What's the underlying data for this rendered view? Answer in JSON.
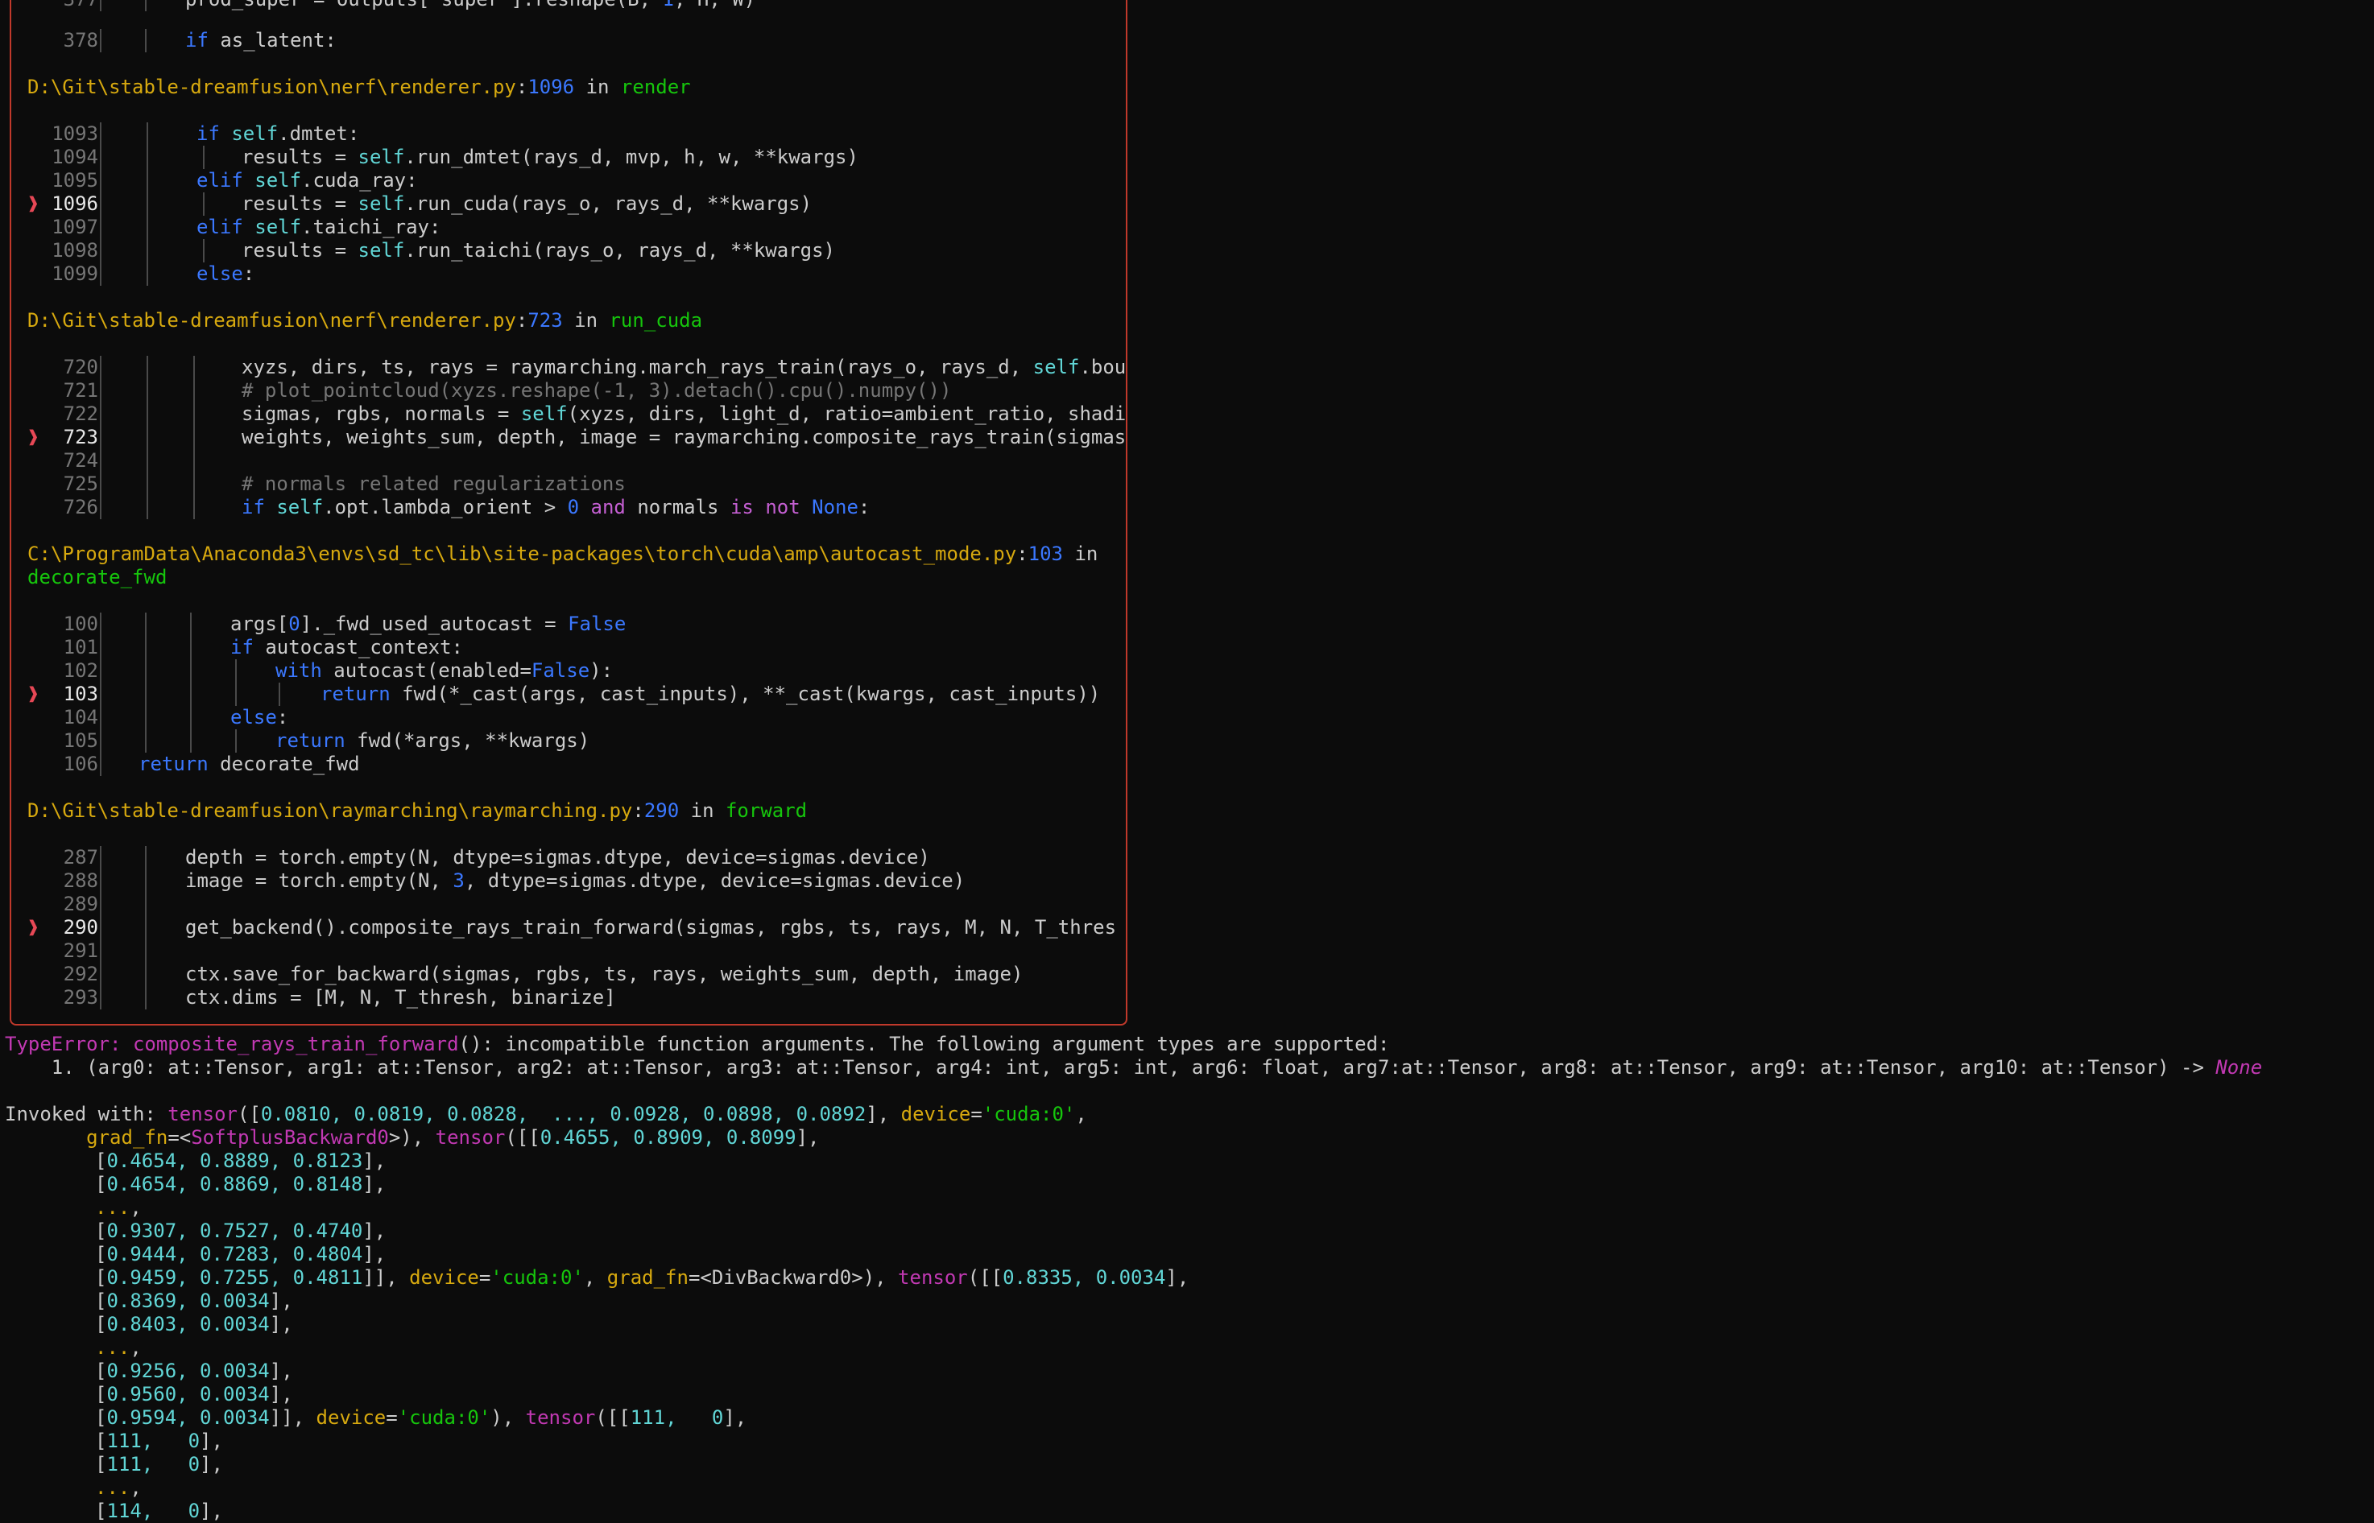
{
  "traceback": {
    "frames": [
      {
        "header": {
          "path": "",
          "line": "",
          "in": "",
          "func": ""
        },
        "lines": [
          {
            "no": "377",
            "code": "prod_super = outputs['super'].reshape(B, 1, H, W)",
            "partial": true
          },
          {
            "no": "378",
            "code": "if as_latent:"
          }
        ]
      }
    ],
    "frame1": {
      "path": "D:\\Git\\stable-dreamfusion\\nerf\\renderer.py",
      "colon": ":",
      "line": "1096",
      "in": " in ",
      "func": "render"
    },
    "frame1_lines": [
      {
        "no": "1093",
        "code": "if self.dmtet:"
      },
      {
        "no": "1094",
        "code": "results = self.run_dmtet(rays_d, mvp, h, w, **kwargs)"
      },
      {
        "no": "1095",
        "code": "elif self.cuda_ray:"
      },
      {
        "no": "1096",
        "code": "results = self.run_cuda(rays_o, rays_d, **kwargs)"
      },
      {
        "no": "1097",
        "code": "elif self.taichi_ray:"
      },
      {
        "no": "1098",
        "code": "results = self.run_taichi(rays_o, rays_d, **kwargs)"
      },
      {
        "no": "1099",
        "code": "else:"
      }
    ],
    "frame2": {
      "path": "D:\\Git\\stable-dreamfusion\\nerf\\renderer.py",
      "colon": ":",
      "line": "723",
      "in": " in ",
      "func": "run_cuda"
    },
    "frame2_lines": [
      {
        "no": "720",
        "code": "xyzs, dirs, ts, rays = raymarching.march_rays_train(rays_o, rays_d, self.bou"
      },
      {
        "no": "721",
        "code": "# plot_pointcloud(xyzs.reshape(-1, 3).detach().cpu().numpy())"
      },
      {
        "no": "722",
        "code": "sigmas, rgbs, normals = self(xyzs, dirs, light_d, ratio=ambient_ratio, shadi"
      },
      {
        "no": "723",
        "code": "weights, weights_sum, depth, image = raymarching.composite_rays_train(sigmas"
      },
      {
        "no": "724",
        "code": ""
      },
      {
        "no": "725",
        "code": "# normals related regularizations"
      },
      {
        "no": "726",
        "code": "if self.opt.lambda_orient > 0 and normals is not None:"
      }
    ],
    "frame3": {
      "path": "C:\\ProgramData\\Anaconda3\\envs\\sd_tc\\lib\\site-packages\\torch\\cuda\\amp\\autocast_mode.py",
      "colon": ":",
      "line": "103",
      "in": " in",
      "func": "decorate_fwd"
    },
    "frame3_lines": [
      {
        "no": "100",
        "code": "args[0]._fwd_used_autocast = False"
      },
      {
        "no": "101",
        "code": "if autocast_context:"
      },
      {
        "no": "102",
        "code": "with autocast(enabled=False):"
      },
      {
        "no": "103",
        "code": "return fwd(*_cast(args, cast_inputs), **_cast(kwargs, cast_inputs))"
      },
      {
        "no": "104",
        "code": "else:"
      },
      {
        "no": "105",
        "code": "return fwd(*args, **kwargs)"
      },
      {
        "no": "106",
        "code": "return decorate_fwd"
      }
    ],
    "frame4": {
      "path": "D:\\Git\\stable-dreamfusion\\raymarching\\raymarching.py",
      "colon": ":",
      "line": "290",
      "in": " in ",
      "func": "forward"
    },
    "frame4_lines": [
      {
        "no": "287",
        "code": "depth = torch.empty(N, dtype=sigmas.dtype, device=sigmas.device)"
      },
      {
        "no": "288",
        "code": "image = torch.empty(N, 3, dtype=sigmas.dtype, device=sigmas.device)"
      },
      {
        "no": "289",
        "code": ""
      },
      {
        "no": "290",
        "code": "get_backend().composite_rays_train_forward(sigmas, rgbs, ts, rays, M, N, T_thres"
      },
      {
        "no": "291",
        "code": ""
      },
      {
        "no": "292",
        "code": "ctx.save_for_backward(sigmas, rgbs, ts, rays, weights_sum, depth, image)"
      },
      {
        "no": "293",
        "code": "ctx.dims = [M, N, T_thresh, binarize]"
      }
    ],
    "arrow": "❱"
  },
  "error": {
    "type": "TypeError:",
    "func": "composite_rays_train_forward",
    "msg": "(): incompatible function arguments. The following argument types are supported:",
    "sig": "    1. (arg0: at::Tensor, arg1: at::Tensor, arg2: at::Tensor, arg3: at::Tensor, arg4: int, arg5: int, arg6: float, arg7:at::Tensor, arg8: at::Tensor, arg9: at::Tensor, arg10: at::Tensor) -> ",
    "sig_ret": "None"
  },
  "invoked": {
    "l1_a": "Invoked with: ",
    "l1_t": "tensor",
    "l1_b": "([",
    "l1_vals": "0.0810, 0.0819, 0.0828,  ..., 0.0928, 0.0898, 0.0892",
    "l1_c": "], ",
    "l1_dev": "device",
    "l1_eq": "=",
    "l1_str": "'cuda:0'",
    "l1_end": ",",
    "l2_a": "       ",
    "l2_grad": "grad_fn",
    "l2_b": "=<",
    "l2_back": "SoftplusBackward0",
    "l2_c": ">), ",
    "l2_t": "tensor",
    "l2_d": "([[",
    "l2_vals": "0.4655, 0.8909, 0.8099",
    "l2_e": "],",
    "rows1": [
      "0.4654, 0.8889, 0.8123",
      "0.4654, 0.8869, 0.8148"
    ],
    "ellipsis": "...",
    "rows2": [
      "0.9307, 0.7527, 0.4740",
      "0.9444, 0.7283, 0.4804"
    ],
    "l9_vals": "0.9459, 0.7255, 0.4811",
    "l9_a": "]], ",
    "l9_dev": "device",
    "l9_eq": "=",
    "l9_str": "'cuda:0'",
    "l9_b": ", ",
    "l9_grad": "grad_fn",
    "l9_c": "=<DivBackward0>), ",
    "l9_t": "tensor",
    "l9_d": "([[",
    "l9_v2": "0.8335, 0.0034",
    "l9_e": "],",
    "rows3": [
      "0.8369, 0.0034",
      "0.8403, 0.0034"
    ],
    "rows4": [
      "0.9256, 0.0034",
      "0.9560, 0.0034"
    ],
    "l16_vals": "0.9594, 0.0034",
    "l16_a": "]], ",
    "l16_dev": "device",
    "l16_eq": "=",
    "l16_str": "'cuda:0'",
    "l16_b": "), ",
    "l16_t": "tensor",
    "l16_c": "([[",
    "l16_v": "111,   0",
    "l16_d": "],",
    "rows5": [
      "111,   0",
      "111,   0"
    ],
    "last": "114,   0"
  }
}
